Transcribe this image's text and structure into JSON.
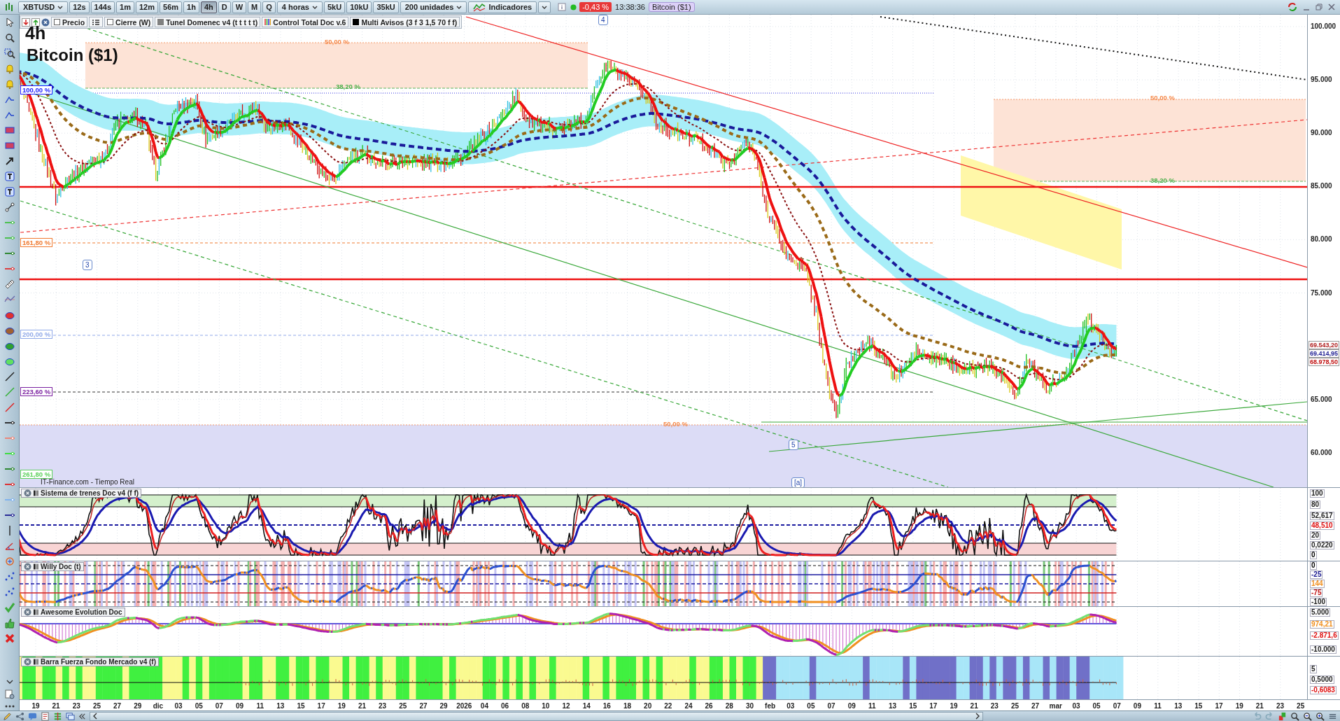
{
  "toolbar": {
    "symbol": "XBTUSD",
    "timeframes": [
      {
        "label": "12s",
        "selected": false
      },
      {
        "label": "144s",
        "selected": false
      },
      {
        "label": "1m",
        "selected": false
      },
      {
        "label": "12m",
        "selected": false
      },
      {
        "label": "56m",
        "selected": false
      },
      {
        "label": "1h",
        "selected": false
      },
      {
        "label": "4h",
        "selected": true
      },
      {
        "label": "D",
        "selected": false
      },
      {
        "label": "W",
        "selected": false
      },
      {
        "label": "M",
        "selected": false
      },
      {
        "label": "Q",
        "selected": false
      }
    ],
    "period": "4 horas",
    "volume_buttons": [
      "5kU",
      "10kU",
      "35kU"
    ],
    "units": "200 unidades",
    "indicators": "Indicadores",
    "change": "-0,43 %",
    "time": "13:38:36",
    "instrument": "Bitcoin ($1)"
  },
  "legend": [
    {
      "kind": "checkbox",
      "label": "Precio",
      "checked": false
    },
    {
      "kind": "list"
    },
    {
      "kind": "checkbox",
      "label": "Cierre (W)",
      "checked": false
    },
    {
      "kind": "swatch",
      "label": "Tunel Domenec v4 (t t t t t)",
      "color": "#808080"
    },
    {
      "kind": "multi",
      "label": "Control Total Doc v.6"
    },
    {
      "kind": "swatch",
      "label": "Multi Avisos (3 f 3 1,5 70 f f)",
      "color": "#000000"
    }
  ],
  "chart": {
    "timeframe": "4h",
    "title": "Bitcoin ($1)",
    "source": "IT-Finance.com - Tiempo Real",
    "fib_labels": [
      {
        "text": "50,00 %",
        "boxed": false,
        "color": "#f5894a"
      },
      {
        "text": "38,20 %",
        "boxed": false,
        "color": "#4cb04c"
      },
      {
        "text": "100,00 %",
        "boxed": true,
        "color": "#1a1aff"
      },
      {
        "text": "161,80 %",
        "boxed": true,
        "color": "#f07a30"
      },
      {
        "text": "200,00 %",
        "boxed": true,
        "color": "#8fa8e8"
      },
      {
        "text": "223,60 %",
        "boxed": true,
        "color": "#7a1fa0"
      },
      {
        "text": "261,80 %",
        "boxed": true,
        "color": "#5ad05a"
      },
      {
        "text": "50,00 %",
        "boxed": false,
        "color": "#f5894a"
      },
      {
        "text": "50,00 %",
        "boxed": false,
        "color": "#f5894a"
      },
      {
        "text": "38,20 %",
        "boxed": false,
        "color": "#4cb04c"
      }
    ],
    "wave_markers": [
      "4",
      "3",
      "5",
      "[a]"
    ],
    "price_axis": [
      "100.000",
      "95.000",
      "90.000",
      "85.000",
      "80.000",
      "75.000",
      "65.000",
      "60.000"
    ],
    "price_tags": [
      {
        "text": "69.543,20",
        "color": "#b02020"
      },
      {
        "text": "69.414,95",
        "color": "#1a1a90"
      },
      {
        "text": "68.978,50",
        "color": "#c01010"
      }
    ]
  },
  "panels": [
    {
      "kind": "trains",
      "title": "Sistema de trenes Doc v4 (f f)",
      "axis": [
        {
          "text": "100",
          "color": "#222222"
        },
        {
          "text": "80",
          "color": "#222222"
        },
        {
          "text": "52,617",
          "color": "#222222"
        },
        {
          "text": "48,510",
          "color": "#e01010"
        },
        {
          "text": "20",
          "color": "#222222"
        },
        {
          "text": "0,0220",
          "color": "#222222"
        },
        {
          "text": "0",
          "color": "#000000"
        }
      ]
    },
    {
      "kind": "willy",
      "title": "Willy Doc (t)",
      "axis": [
        {
          "text": "0",
          "color": "#000000"
        },
        {
          "text": "-25",
          "color": "#1a1a90"
        },
        {
          "text": "144",
          "color": "#f09020"
        },
        {
          "text": "-75",
          "color": "#c01010"
        },
        {
          "text": "-100",
          "color": "#222222"
        }
      ]
    },
    {
      "kind": "awesome",
      "title": "Awesome Evolution Doc",
      "axis": [
        {
          "text": "5.000",
          "color": "#222222"
        },
        {
          "text": "974,21",
          "color": "#f09020"
        },
        {
          "text": "-2.871,6",
          "color": "#e01010"
        },
        {
          "text": "-10.000",
          "color": "#222222"
        }
      ]
    },
    {
      "kind": "strength",
      "title": "Barra Fuerza Fondo Mercado v4 (f)",
      "axis": [
        {
          "text": "5",
          "color": "#222222"
        },
        {
          "text": "0,5000",
          "color": "#222222"
        },
        {
          "text": "-0,6083",
          "color": "#e01010"
        }
      ]
    }
  ],
  "date_axis": [
    "19",
    "21",
    "23",
    "25",
    "27",
    "29",
    "dic",
    "03",
    "05",
    "07",
    "09",
    "11",
    "13",
    "15",
    "17",
    "19",
    "21",
    "23",
    "25",
    "27",
    "29",
    "2026",
    "04",
    "06",
    "08",
    "10",
    "12",
    "14",
    "16",
    "18",
    "20",
    "22",
    "24",
    "26",
    "28",
    "30",
    "feb",
    "03",
    "05",
    "07",
    "09",
    "11",
    "13",
    "15",
    "17",
    "19",
    "21",
    "23",
    "25",
    "27",
    "mar",
    "03",
    "05",
    "07",
    "09",
    "11",
    "13",
    "15",
    "17",
    "19",
    "21",
    "23",
    "25"
  ]
}
